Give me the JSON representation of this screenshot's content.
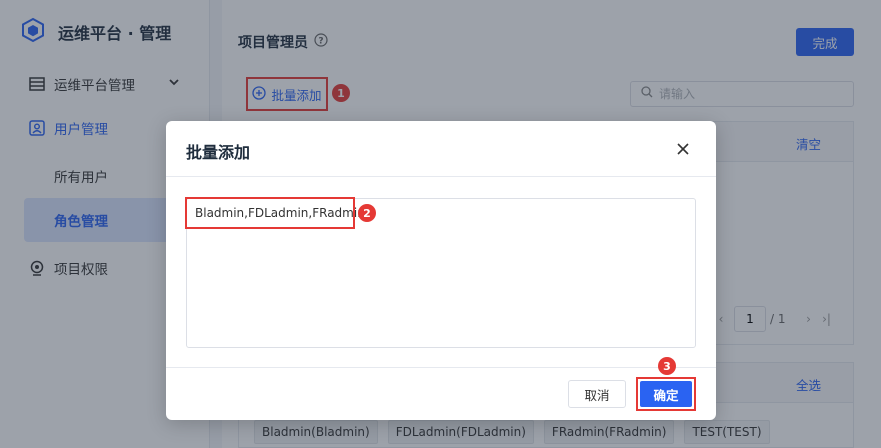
{
  "brand": {
    "title": "运维平台 · 管理",
    "logo_icon": "cube-icon",
    "accent": "#2a63f2"
  },
  "sidebar": {
    "items": [
      {
        "label": "运维平台管理",
        "icon": "server-icon",
        "expand_icon": "chevron-down-icon"
      },
      {
        "label": "用户管理",
        "icon": "user-manage-icon"
      },
      {
        "label": "所有用户"
      },
      {
        "label": "角色管理"
      },
      {
        "label": "项目权限",
        "icon": "webcam-icon"
      }
    ]
  },
  "main": {
    "title": "项目管理员",
    "help_icon": "question-circle-icon",
    "done_label": "完成",
    "batch_add_label": "批量添加",
    "search_placeholder": "请输入",
    "clear_label": "清空",
    "pager": {
      "current": "1",
      "total": "/ 1"
    },
    "select_all_label": "全选",
    "tags": [
      "Bladmin(Bladmin)",
      "FDLadmin(FDLadmin)",
      "FRadmin(FRadmin)",
      "TEST(TEST)"
    ]
  },
  "badges": {
    "one": "1",
    "two": "2",
    "three": "3"
  },
  "modal": {
    "title": "批量添加",
    "textarea_value": "Bladmin,FDLadmin,FRadmin",
    "cancel_label": "取消",
    "ok_label": "确定"
  },
  "colors": {
    "primary": "#2a63f2",
    "highlight": "#e53935"
  }
}
